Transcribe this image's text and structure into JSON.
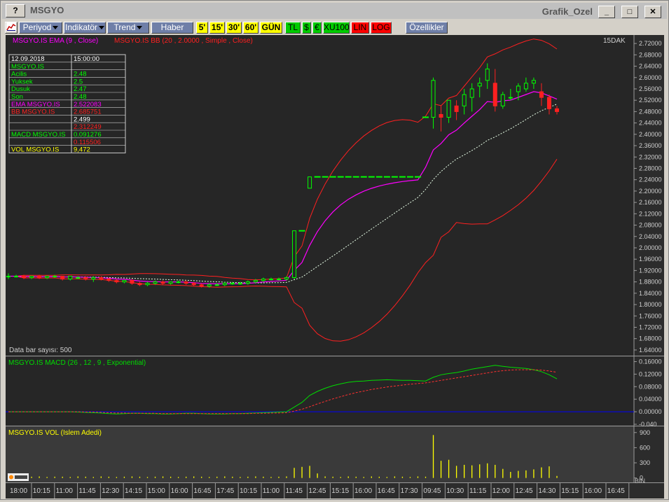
{
  "window": {
    "title": "MSGYO",
    "right_title": "Grafik_Ozel",
    "help": "?",
    "min": "_",
    "max": "□",
    "close": "✕"
  },
  "toolbar": {
    "periyod": "Periyod",
    "indikator": "Indikatör",
    "trend": "Trend",
    "haber": "Haber",
    "periods": [
      {
        "label": "5'",
        "bg": "#ffff00",
        "fg": "#000000"
      },
      {
        "label": "15'",
        "bg": "#ffff00",
        "fg": "#000000"
      },
      {
        "label": "30'",
        "bg": "#ffff00",
        "fg": "#000000"
      },
      {
        "label": "60'",
        "bg": "#ffff00",
        "fg": "#000000"
      },
      {
        "label": "GÜN",
        "bg": "#ffff00",
        "fg": "#000000"
      }
    ],
    "modes": [
      {
        "label": "TL",
        "bg": "#00cc00",
        "fg": "#000000"
      },
      {
        "label": "$",
        "bg": "#00cc00",
        "fg": "#000000"
      },
      {
        "label": "€",
        "bg": "#00cc00",
        "fg": "#000000"
      },
      {
        "label": "XU100",
        "bg": "#00cc00",
        "fg": "#000000"
      },
      {
        "label": "LIN",
        "bg": "#ff0000",
        "fg": "#000000"
      },
      {
        "label": "LOG",
        "bg": "#ff0000",
        "fg": "#000000"
      }
    ],
    "ozellikler": "Özellikler"
  },
  "legend": {
    "ema": "MSGYO.IS EMA (9 , Close)",
    "bb": "MSGYO.IS BB (20 , 2.0000 , Simple , Close)",
    "period": "15DAK",
    "bars": "Data bar sayısı: 500",
    "macd": "MSGYO.IS MACD (26 , 12 , 9 , Exponential)",
    "vol": "MSGYO.IS VOL (Islem Adedi)",
    "bin": "BIN"
  },
  "info": {
    "date": "12.09.2018",
    "time": "15:00:00",
    "symbol": "MSGYO.IS",
    "rows": [
      {
        "label": " Acilis",
        "value": "2.48",
        "lc": "#00ff00",
        "vc": "#00ff00"
      },
      {
        "label": " Yuksek",
        "value": "2.5",
        "lc": "#00ff00",
        "vc": "#00ff00"
      },
      {
        "label": " Dusuk",
        "value": "2.47",
        "lc": "#00ff00",
        "vc": "#00ff00"
      },
      {
        "label": " Son",
        "value": "2.48",
        "lc": "#00ff00",
        "vc": "#00ff00"
      },
      {
        "label": "EMA MSGYO.IS",
        "value": "2.522083",
        "lc": "#ff00ff",
        "vc": "#ff00ff"
      },
      {
        "label": "BB MSGYO.IS",
        "value": "2.685751",
        "lc": "#ff2020",
        "vc": "#ff2020"
      },
      {
        "label": "",
        "value": "2.499",
        "lc": "#ffffff",
        "vc": "#ffffff"
      },
      {
        "label": "",
        "value": "2.312249",
        "lc": "#ff2020",
        "vc": "#ff2020"
      },
      {
        "label": "MACD MSGYO.IS",
        "value": "0.091276",
        "lc": "#00ff00",
        "vc": "#00ff00"
      },
      {
        "label": "",
        "value": "0.115506",
        "lc": "#ff2020",
        "vc": "#ff2020"
      },
      {
        "label": "VOL MSGYO.IS",
        "value": "9,472",
        "lc": "#ffff00",
        "vc": "#ffff00"
      }
    ]
  },
  "chart_data": [
    {
      "type": "candlestick",
      "title": "MSGYO.IS",
      "ylim": [
        1.62,
        2.74
      ],
      "yticks": [
        "2.72000",
        "2.68000",
        "2.64000",
        "2.60000",
        "2.56000",
        "2.52000",
        "2.48000",
        "2.44000",
        "2.40000",
        "2.36000",
        "2.32000",
        "2.28000",
        "2.24000",
        "2.20000",
        "2.16000",
        "2.12000",
        "2.08000",
        "2.04000",
        "2.00000",
        "1.96000",
        "1.92000",
        "1.88000",
        "1.84000",
        "1.80000",
        "1.76000",
        "1.72000",
        "1.68000",
        "1.64000"
      ],
      "xticks": [
        "18:00",
        "10:15",
        "11:00",
        "11:45",
        "12:30",
        "14:15",
        "15:00",
        "16:00",
        "16:45",
        "17:45",
        "10:15",
        "11:00",
        "11:45",
        "12:45",
        "15:15",
        "16:00",
        "16:45",
        "17:30",
        "09:45",
        "10:30",
        "11:15",
        "12:00",
        "12:45",
        "14:30",
        "15:15",
        "16:00",
        "16:45"
      ],
      "candles": [
        [
          1.9,
          1.91,
          1.89,
          1.9
        ],
        [
          1.9,
          1.905,
          1.895,
          1.9
        ],
        [
          1.9,
          1.905,
          1.89,
          1.895
        ],
        [
          1.895,
          1.9,
          1.89,
          1.9
        ],
        [
          1.9,
          1.905,
          1.89,
          1.895
        ],
        [
          1.895,
          1.9,
          1.89,
          1.9
        ],
        [
          1.9,
          1.905,
          1.895,
          1.9
        ],
        [
          1.9,
          1.9,
          1.885,
          1.89
        ],
        [
          1.89,
          1.9,
          1.885,
          1.9
        ],
        [
          1.895,
          1.9,
          1.89,
          1.895
        ],
        [
          1.895,
          1.9,
          1.885,
          1.89
        ],
        [
          1.89,
          1.9,
          1.88,
          1.895
        ],
        [
          1.895,
          1.9,
          1.885,
          1.89
        ],
        [
          1.89,
          1.895,
          1.88,
          1.885
        ],
        [
          1.885,
          1.89,
          1.875,
          1.88
        ],
        [
          1.88,
          1.885,
          1.875,
          1.885
        ],
        [
          1.885,
          1.89,
          1.87,
          1.875
        ],
        [
          1.875,
          1.88,
          1.865,
          1.87
        ],
        [
          1.87,
          1.88,
          1.865,
          1.875
        ],
        [
          1.875,
          1.885,
          1.87,
          1.88
        ],
        [
          1.88,
          1.885,
          1.87,
          1.875
        ],
        [
          1.875,
          1.88,
          1.87,
          1.88
        ],
        [
          1.88,
          1.885,
          1.875,
          1.88
        ],
        [
          1.88,
          1.885,
          1.87,
          1.875
        ],
        [
          1.875,
          1.88,
          1.865,
          1.87
        ],
        [
          1.87,
          1.875,
          1.86,
          1.865
        ],
        [
          1.865,
          1.875,
          1.86,
          1.87
        ],
        [
          1.87,
          1.875,
          1.865,
          1.87
        ],
        [
          1.87,
          1.88,
          1.865,
          1.875
        ],
        [
          1.875,
          1.88,
          1.87,
          1.875
        ],
        [
          1.875,
          1.88,
          1.87,
          1.875
        ],
        [
          1.875,
          1.885,
          1.87,
          1.88
        ],
        [
          1.88,
          1.89,
          1.875,
          1.885
        ],
        [
          1.885,
          1.895,
          1.88,
          1.89
        ],
        [
          1.89,
          1.895,
          1.885,
          1.89
        ],
        [
          1.89,
          1.895,
          1.885,
          1.89
        ],
        [
          1.89,
          1.9,
          1.885,
          1.895
        ],
        [
          1.895,
          2.06,
          1.89,
          2.06
        ],
        [
          2.06,
          2.06,
          2.06,
          2.06
        ],
        [
          2.21,
          2.25,
          2.21,
          2.25
        ],
        [
          2.25,
          2.25,
          2.25,
          2.25
        ],
        [
          2.25,
          2.25,
          2.25,
          2.25
        ],
        [
          2.25,
          2.25,
          2.25,
          2.25
        ],
        [
          2.25,
          2.25,
          2.25,
          2.25
        ],
        [
          2.25,
          2.25,
          2.25,
          2.25
        ],
        [
          2.25,
          2.25,
          2.25,
          2.25
        ],
        [
          2.25,
          2.25,
          2.25,
          2.25
        ],
        [
          2.25,
          2.25,
          2.25,
          2.25
        ],
        [
          2.25,
          2.25,
          2.25,
          2.25
        ],
        [
          2.25,
          2.25,
          2.25,
          2.25
        ],
        [
          2.25,
          2.25,
          2.25,
          2.25
        ],
        [
          2.25,
          2.25,
          2.25,
          2.25
        ],
        [
          2.25,
          2.25,
          2.25,
          2.25
        ],
        [
          2.25,
          2.25,
          2.25,
          2.25
        ],
        [
          2.46,
          2.46,
          2.46,
          2.46
        ],
        [
          2.46,
          2.6,
          2.42,
          2.59
        ],
        [
          2.47,
          2.5,
          2.41,
          2.46
        ],
        [
          2.46,
          2.52,
          2.44,
          2.52
        ],
        [
          2.5,
          2.52,
          2.45,
          2.48
        ],
        [
          2.5,
          2.56,
          2.47,
          2.54
        ],
        [
          2.53,
          2.58,
          2.48,
          2.56
        ],
        [
          2.57,
          2.6,
          2.53,
          2.58
        ],
        [
          2.59,
          2.65,
          2.56,
          2.63
        ],
        [
          2.58,
          2.63,
          2.48,
          2.5
        ],
        [
          2.5,
          2.55,
          2.49,
          2.54
        ],
        [
          2.53,
          2.56,
          2.52,
          2.53
        ],
        [
          2.55,
          2.58,
          2.52,
          2.57
        ],
        [
          2.56,
          2.6,
          2.55,
          2.58
        ],
        [
          2.58,
          2.6,
          2.56,
          2.59
        ],
        [
          2.55,
          2.58,
          2.5,
          2.53
        ],
        [
          2.53,
          2.54,
          2.47,
          2.49
        ],
        [
          2.49,
          2.5,
          2.47,
          2.48
        ]
      ],
      "series": [
        {
          "name": "EMA MSGYO.IS",
          "color": "#ff00ff"
        },
        {
          "name": "BB MSGYO.IS",
          "color": "#ff2020"
        }
      ]
    },
    {
      "type": "line",
      "title": "MSGYO.IS MACD (26 , 12 , 9 , Exponential)",
      "ylim": [
        -0.04,
        0.17
      ],
      "yticks": [
        "0.16000",
        "0.12000",
        "0.08000",
        "0.04000",
        "0.00000",
        "-0.040"
      ],
      "series": [
        {
          "name": "MACD MSGYO.IS",
          "color": "#00dd00",
          "values": [
            0,
            0,
            0,
            0,
            0,
            0,
            0,
            0,
            0,
            -0.001,
            -0.002,
            -0.003,
            -0.004,
            -0.006,
            -0.007,
            -0.006,
            -0.005,
            -0.005,
            -0.006,
            -0.006,
            -0.007,
            -0.007,
            -0.006,
            -0.005,
            -0.005,
            -0.006,
            -0.007,
            -0.007,
            -0.007,
            -0.006,
            -0.006,
            -0.005,
            -0.004,
            -0.003,
            -0.002,
            -0.001,
            0,
            0.015,
            0.03,
            0.052,
            0.065,
            0.075,
            0.083,
            0.089,
            0.094,
            0.097,
            0.098,
            0.1,
            0.101,
            0.102,
            0.101,
            0.1,
            0.1,
            0.099,
            0.098,
            0.11,
            0.118,
            0.122,
            0.125,
            0.13,
            0.136,
            0.14,
            0.144,
            0.148,
            0.145,
            0.142,
            0.14,
            0.138,
            0.134,
            0.128,
            0.118,
            0.105
          ]
        },
        {
          "name": "Signal",
          "color": "#ff3030",
          "values": [
            0,
            0,
            0,
            0,
            0,
            0,
            0,
            0,
            0,
            0,
            -0.001,
            -0.001,
            -0.002,
            -0.003,
            -0.004,
            -0.004,
            -0.005,
            -0.005,
            -0.005,
            -0.005,
            -0.006,
            -0.006,
            -0.006,
            -0.006,
            -0.006,
            -0.006,
            -0.006,
            -0.006,
            -0.006,
            -0.006,
            -0.006,
            -0.006,
            -0.005,
            -0.005,
            -0.004,
            -0.004,
            -0.003,
            0.002,
            0.008,
            0.016,
            0.025,
            0.033,
            0.041,
            0.048,
            0.055,
            0.061,
            0.066,
            0.071,
            0.075,
            0.079,
            0.082,
            0.085,
            0.088,
            0.09,
            0.092,
            0.096,
            0.1,
            0.104,
            0.108,
            0.112,
            0.116,
            0.12,
            0.124,
            0.128,
            0.131,
            0.133,
            0.134,
            0.134,
            0.134,
            0.133,
            0.13,
            0.126
          ]
        }
      ]
    },
    {
      "type": "bar",
      "title": "MSGYO.IS VOL (Islem Adedi)",
      "ylim": [
        -60,
        980
      ],
      "yticks": [
        "900",
        "600",
        "300",
        "0"
      ],
      "values": [
        30,
        25,
        20,
        25,
        30,
        20,
        25,
        25,
        20,
        30,
        25,
        20,
        30,
        25,
        20,
        25,
        30,
        25,
        20,
        25,
        30,
        25,
        20,
        25,
        30,
        25,
        20,
        25,
        30,
        25,
        20,
        25,
        30,
        25,
        20,
        25,
        30,
        200,
        220,
        240,
        90,
        30,
        25,
        20,
        30,
        25,
        20,
        30,
        25,
        20,
        30,
        25,
        20,
        30,
        25,
        850,
        340,
        360,
        240,
        260,
        250,
        270,
        290,
        260,
        180,
        120,
        140,
        150,
        170,
        210,
        230,
        40
      ]
    }
  ]
}
